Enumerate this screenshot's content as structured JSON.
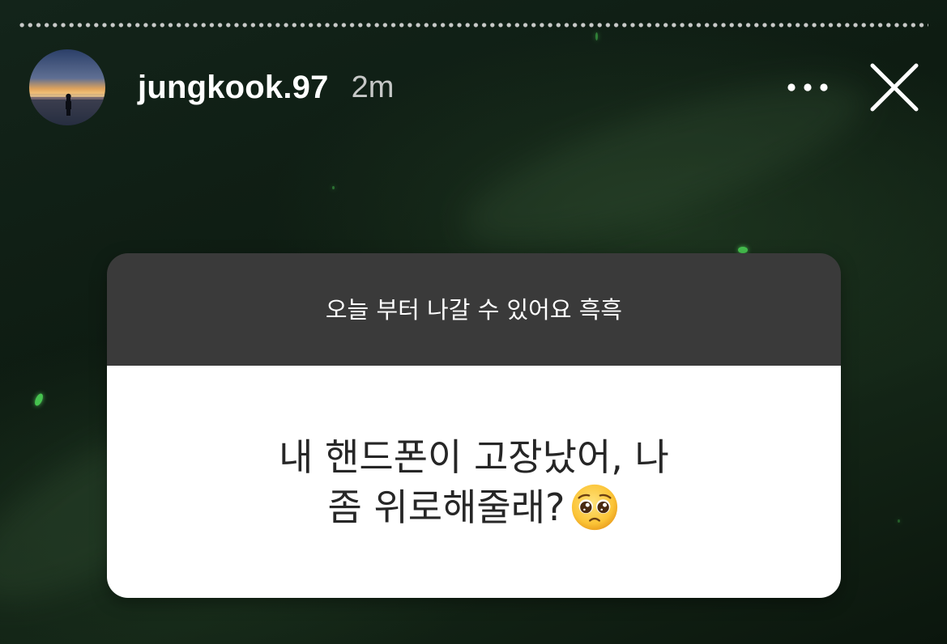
{
  "story": {
    "progress": 0.0
  },
  "header": {
    "username": "jungkook.97",
    "timestamp": "2m",
    "avatar_icon": "sunset-beach-silhouette-avatar",
    "more_icon": "more-horizontal-icon",
    "close_icon": "close-icon"
  },
  "sticker": {
    "question": "오늘 부터 나갈 수 있어요 흑흑",
    "answer_line1": "내 핸드폰이 고장났어, 나",
    "answer_line2": "좀 위로해줄래?",
    "emoji_icon": "pleading-face-emoji",
    "top_color": "#3a3a3a",
    "bottom_color": "#ffffff"
  }
}
